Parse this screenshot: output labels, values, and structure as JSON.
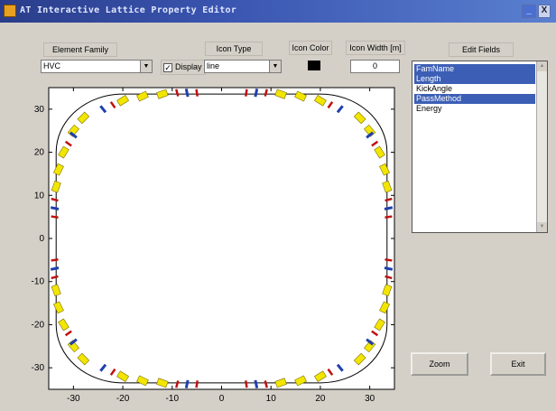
{
  "window": {
    "title": "AT Interactive Lattice Property Editor",
    "min_label": "_",
    "close_label": "X"
  },
  "controls": {
    "element_family_label": "Element Family",
    "element_family_value": "HVC",
    "icon_type_label": "Icon Type",
    "icon_type_value": "line",
    "display_label": "Display",
    "display_checked": "✓",
    "icon_color_label": "Icon Color",
    "icon_color": "#000000",
    "icon_width_label": "Icon Width [m]",
    "icon_width_value": "0",
    "edit_fields_label": "Edit Fields",
    "dropdown_arrow": "▼"
  },
  "edit_fields": [
    {
      "label": "FamName",
      "selected": true
    },
    {
      "label": "Length",
      "selected": true
    },
    {
      "label": "KickAngle",
      "selected": false
    },
    {
      "label": "PassMethod",
      "selected": true
    },
    {
      "label": "Energy",
      "selected": false
    }
  ],
  "buttons": {
    "zoom": "Zoom",
    "exit": "Exit"
  },
  "chart_data": {
    "type": "scatter",
    "title": "",
    "xlabel": "",
    "ylabel": "",
    "xlim": [
      -35,
      35
    ],
    "ylim": [
      -35,
      35
    ],
    "xticks": [
      -30,
      -20,
      -10,
      0,
      10,
      20,
      30
    ],
    "yticks": [
      -30,
      -20,
      -10,
      0,
      10,
      20,
      30
    ],
    "colors": {
      "ring": "#000000",
      "dipole": "#f2e600",
      "quad_blue": "#1f3fb0",
      "sext_red": "#c01010"
    },
    "ring": {
      "straight_half_length": 20,
      "radius": 13.5
    },
    "dipoles": [
      [
        -12,
        33.5
      ],
      [
        -16,
        33.0
      ],
      [
        12,
        33.5
      ],
      [
        16,
        33.0
      ],
      [
        -12,
        -33.5
      ],
      [
        -16,
        -33.0
      ],
      [
        12,
        -33.5
      ],
      [
        16,
        -33.0
      ],
      [
        -28,
        28
      ],
      [
        -30,
        25
      ],
      [
        28,
        28
      ],
      [
        30,
        25
      ],
      [
        -28,
        -28
      ],
      [
        -30,
        -25
      ],
      [
        28,
        -28
      ],
      [
        30,
        -25
      ],
      [
        -33,
        16
      ],
      [
        -33.5,
        12
      ],
      [
        33,
        16
      ],
      [
        33.5,
        12
      ],
      [
        -33,
        -16
      ],
      [
        -33.5,
        -12
      ],
      [
        33,
        -16
      ],
      [
        33.5,
        -12
      ],
      [
        -20,
        32
      ],
      [
        20,
        32
      ],
      [
        -20,
        -32
      ],
      [
        20,
        -32
      ],
      [
        -32,
        20
      ],
      [
        32,
        20
      ],
      [
        -32,
        -20
      ],
      [
        32,
        -20
      ]
    ],
    "quads_blue": [
      [
        -7,
        33.8
      ],
      [
        7,
        33.8
      ],
      [
        -7,
        -33.8
      ],
      [
        7,
        -33.8
      ],
      [
        -33.8,
        7
      ],
      [
        -33.8,
        -7
      ],
      [
        33.8,
        7
      ],
      [
        33.8,
        -7
      ],
      [
        -24,
        30
      ],
      [
        24,
        30
      ],
      [
        -24,
        -30
      ],
      [
        24,
        -30
      ],
      [
        -30,
        24
      ],
      [
        30,
        24
      ],
      [
        -30,
        -24
      ],
      [
        30,
        -24
      ]
    ],
    "sexts_red": [
      [
        -5,
        33.8
      ],
      [
        -9,
        33.8
      ],
      [
        5,
        33.8
      ],
      [
        9,
        33.8
      ],
      [
        -5,
        -33.8
      ],
      [
        -9,
        -33.8
      ],
      [
        5,
        -33.8
      ],
      [
        9,
        -33.8
      ],
      [
        -33.8,
        5
      ],
      [
        -33.8,
        9
      ],
      [
        -33.8,
        -5
      ],
      [
        -33.8,
        -9
      ],
      [
        33.8,
        5
      ],
      [
        33.8,
        9
      ],
      [
        33.8,
        -5
      ],
      [
        33.8,
        -9
      ],
      [
        -22,
        31
      ],
      [
        22,
        31
      ],
      [
        -22,
        -31
      ],
      [
        22,
        -31
      ],
      [
        -31,
        22
      ],
      [
        31,
        22
      ],
      [
        -31,
        -22
      ],
      [
        31,
        -22
      ]
    ]
  }
}
